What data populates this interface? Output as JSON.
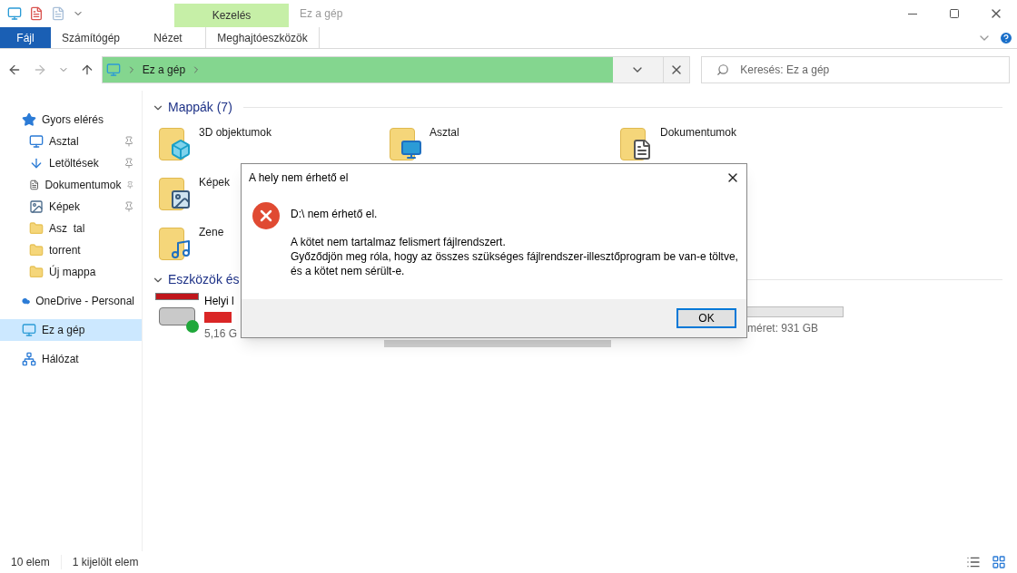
{
  "titlebar": {
    "context_tab": "Kezelés",
    "title": "Ez a gép"
  },
  "ribbon_tabs": [
    {
      "label": "Fájl",
      "kind": "file",
      "selected": false
    },
    {
      "label": "Számítógép",
      "kind": "tab",
      "selected": false
    },
    {
      "label": "Nézet",
      "kind": "tab",
      "selected": false
    },
    {
      "label": "Meghajtóeszközök",
      "kind": "context",
      "selected": true
    }
  ],
  "address": {
    "crumb": "Ez a gép",
    "level": 0.87
  },
  "search": {
    "placeholder": "Keresés: Ez a gép"
  },
  "sidebar": {
    "items": [
      {
        "label": "Gyors elérés",
        "kind": "star",
        "pinned": false,
        "selected": false,
        "children": [
          {
            "label": "Asztal",
            "kind": "desktop",
            "pinned": true,
            "selected": false
          },
          {
            "label": "Letöltések",
            "kind": "download",
            "pinned": true,
            "selected": false
          },
          {
            "label": "Dokumentumok",
            "kind": "document",
            "pinned": true,
            "selected": false
          },
          {
            "label": "Képek",
            "kind": "picture",
            "pinned": true,
            "selected": false
          },
          {
            "label": "Asz  tal",
            "kind": "folder",
            "pinned": false,
            "selected": false
          },
          {
            "label": "torrent",
            "kind": "folder",
            "pinned": false,
            "selected": false
          },
          {
            "label": "Új mappa",
            "kind": "folder",
            "pinned": false,
            "selected": false
          }
        ]
      },
      {
        "label": "OneDrive - Personal",
        "kind": "cloud",
        "pinned": false,
        "selected": false
      },
      {
        "label": "Ez a gép",
        "kind": "pc",
        "pinned": false,
        "selected": true
      },
      {
        "label": "Hálózat",
        "kind": "network",
        "pinned": false,
        "selected": false
      }
    ]
  },
  "folders": {
    "heading": "Mappák (7)",
    "rows": [
      [
        {
          "label": "3D objektumok",
          "kind": "cube"
        },
        {
          "label": "Asztal",
          "kind": "desktop"
        },
        {
          "label": "Dokumentumok",
          "kind": "document"
        }
      ],
      [
        {
          "label": "Képek",
          "kind": "picture"
        }
      ],
      [
        {
          "label": "Zene",
          "kind": "music"
        }
      ]
    ]
  },
  "devices": {
    "heading": "Eszközök és",
    "drive": {
      "name": "Helyi l",
      "size": "5,16 G"
    },
    "drive_3": {
      "size": "méret: 931 GB"
    }
  },
  "dialog": {
    "title": "A hely nem érhető el",
    "heading": "D:\\ nem érhető el.",
    "lines": [
      "A kötet nem tartalmaz felismert fájlrendszert.",
      "Győződjön meg róla, hogy az összes szükséges fájlrendszer-illesztőprogram be van-e töltve, és a kötet nem sérült-e."
    ],
    "button": "OK"
  },
  "status_bar": {
    "count": "10 elem",
    "selection": "1 kijelölt elem"
  }
}
